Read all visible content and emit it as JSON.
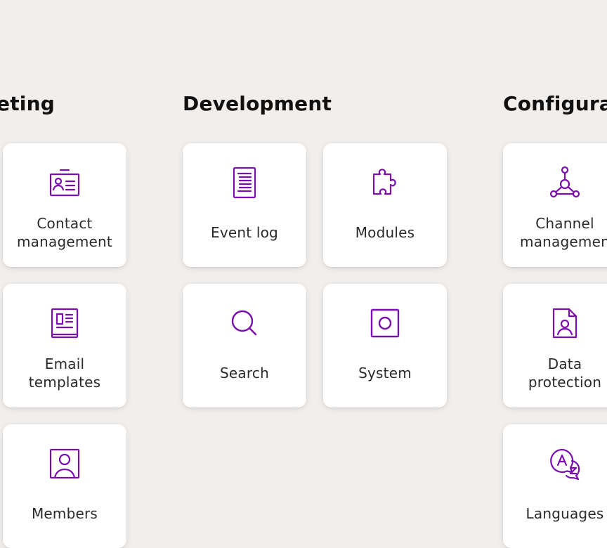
{
  "accent_color": "#7a0fb0",
  "sections": {
    "marketing": {
      "title": "eting",
      "tiles": [
        {
          "label": "Contact\nmanagement",
          "icon": "contact-card-icon"
        },
        {
          "label": "Email\ntemplates",
          "icon": "email-template-icon"
        },
        {
          "label": "Members",
          "icon": "member-portrait-icon"
        }
      ]
    },
    "development": {
      "title": "Development",
      "tiles": [
        {
          "label": "Event log",
          "icon": "document-log-icon"
        },
        {
          "label": "Modules",
          "icon": "puzzle-piece-icon"
        },
        {
          "label": "Search",
          "icon": "magnifier-icon"
        },
        {
          "label": "System",
          "icon": "system-square-icon"
        }
      ]
    },
    "configuration": {
      "title": "Configura",
      "tiles": [
        {
          "label": "Channel\nmanagemen",
          "icon": "channel-network-icon"
        },
        {
          "label": "Data\nprotection",
          "icon": "data-protection-icon"
        },
        {
          "label": "Languages",
          "icon": "languages-icon"
        }
      ]
    }
  }
}
